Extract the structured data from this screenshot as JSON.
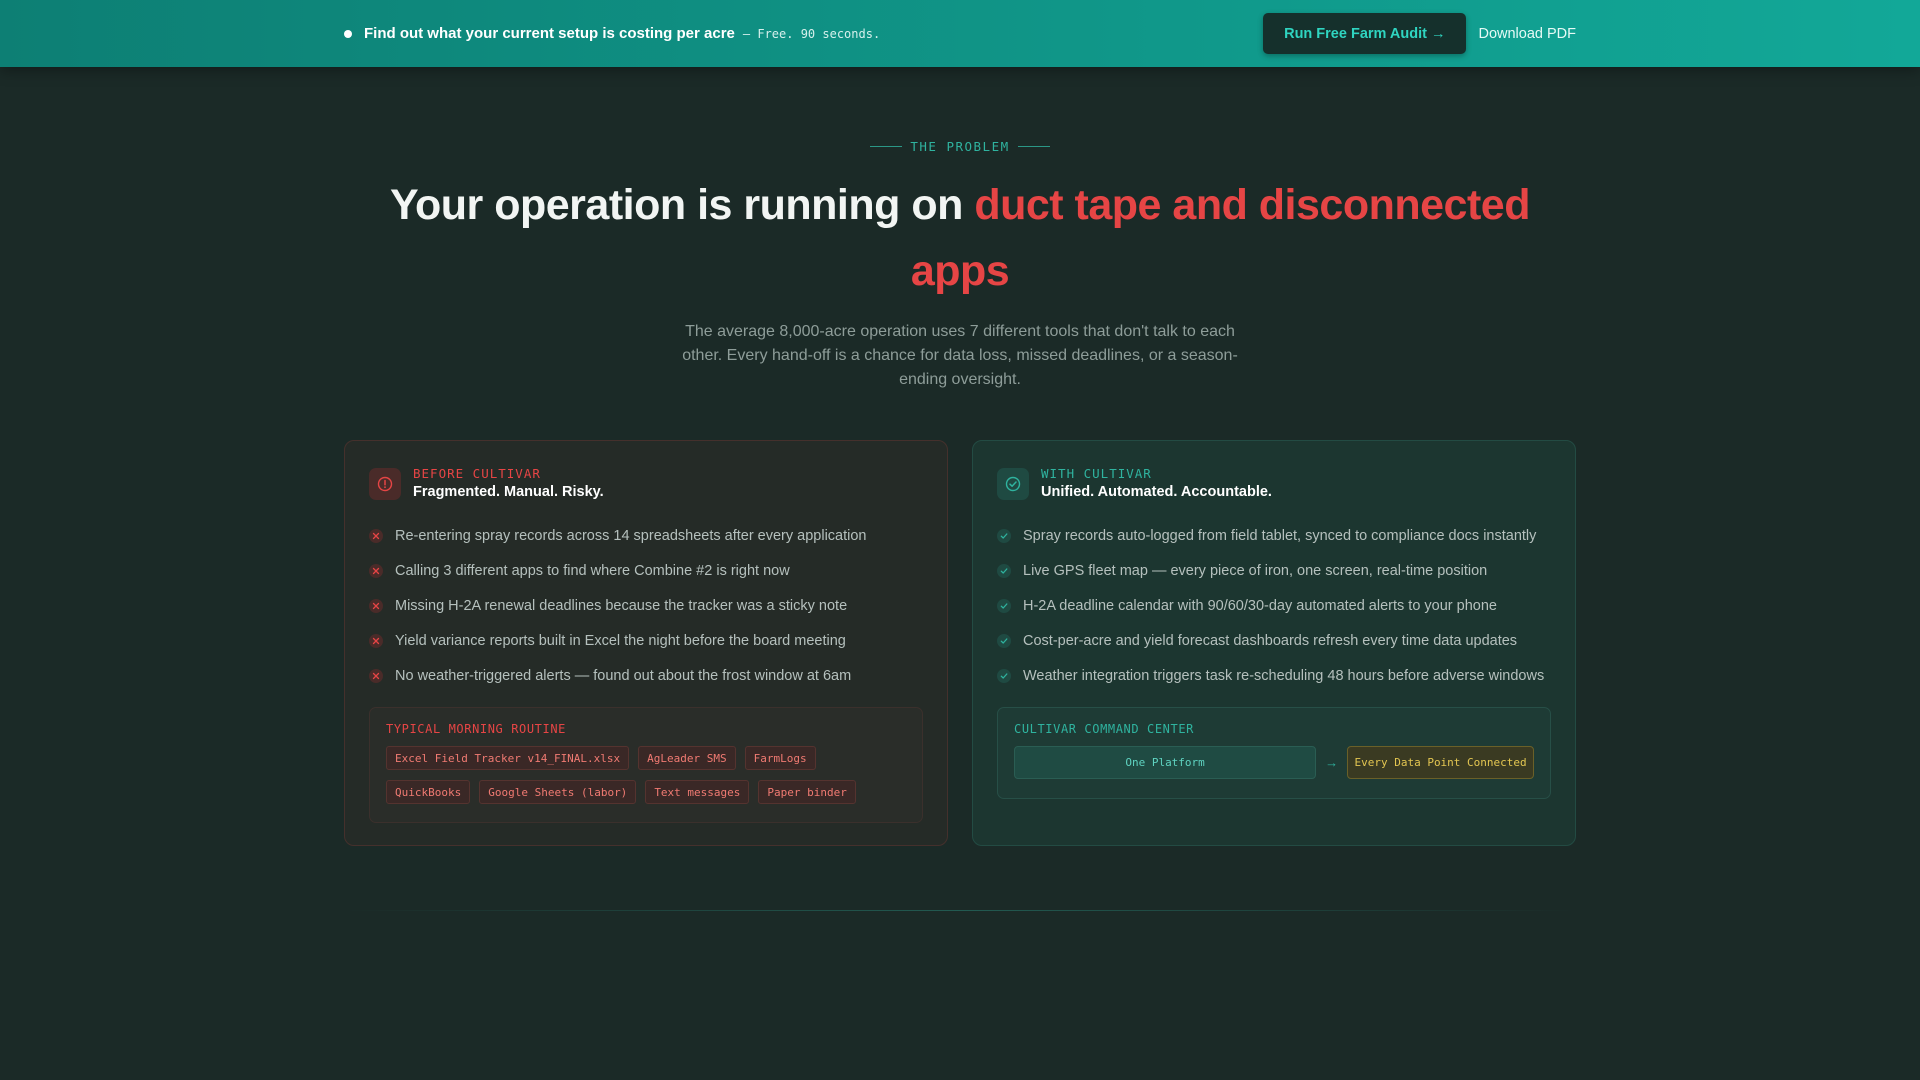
{
  "banner": {
    "message": "Find out what your current setup is costing per acre",
    "note": "— Free. 90 seconds.",
    "cta_label": "Run Free Farm Audit →",
    "pdf_label": "Download PDF"
  },
  "section": {
    "label": "THE PROBLEM",
    "headline_plain": "Your operation is running on ",
    "headline_accent": "duct tape and disconnected apps",
    "subtext": "The average 8,000-acre operation uses 7 different tools that don't talk to each other. Every hand-off is a chance for data loss, missed deadlines, or a season-ending oversight."
  },
  "before": {
    "kicker": "BEFORE CULTIVAR",
    "title": "Fragmented. Manual. Risky.",
    "items": [
      "Re-entering spray records across 14 spreadsheets after every application",
      "Calling 3 different apps to find where Combine #2 is right now",
      "Missing H-2A renewal deadlines because the tracker was a sticky note",
      "Yield variance reports built in Excel the night before the board meeting",
      "No weather-triggered alerts — found out about the frost window at 6am"
    ],
    "panel_label": "TYPICAL MORNING ROUTINE",
    "tags": [
      "Excel Field Tracker v14_FINAL.xlsx",
      "AgLeader SMS",
      "FarmLogs",
      "QuickBooks",
      "Google Sheets (labor)",
      "Text messages",
      "Paper binder"
    ]
  },
  "after": {
    "kicker": "WITH CULTIVAR",
    "title": "Unified. Automated. Accountable.",
    "items": [
      "Spray records auto-logged from field tablet, synced to compliance docs instantly",
      "Live GPS fleet map — every piece of iron, one screen, real-time position",
      "H-2A deadline calendar with 90/60/30-day automated alerts to your phone",
      "Cost-per-acre and yield forecast dashboards refresh every time data updates",
      "Weather integration triggers task re-scheduling 48 hours before adverse windows"
    ],
    "panel_label": "CULTIVAR COMMAND CENTER",
    "flow_from": "One Platform",
    "flow_arrow": "→",
    "flow_to": "Every Data Point Connected"
  },
  "colors": {
    "accent_red": "#e64545",
    "accent_teal": "#2fb39f",
    "background": "#1b2a27"
  },
  "icons": {
    "before": "alert-circle-icon",
    "after": "check-circle-icon",
    "before_item": "x-mark-icon",
    "after_item": "check-mark-icon"
  }
}
